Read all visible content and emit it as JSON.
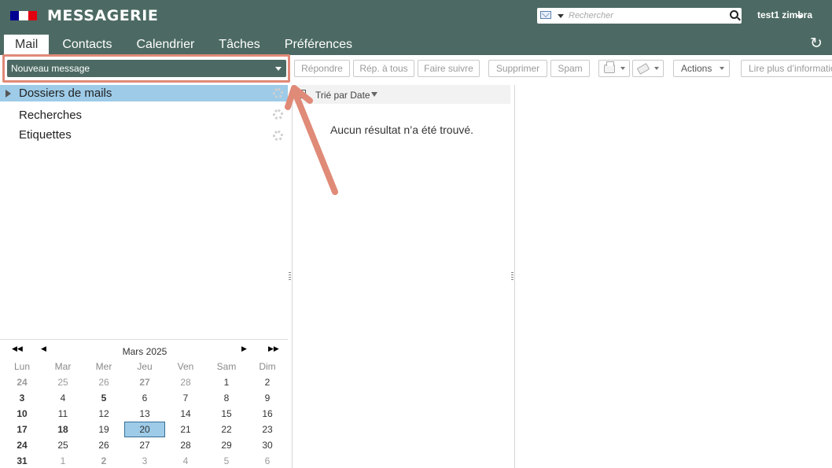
{
  "header": {
    "app_title": "MESSAGERIE",
    "search_placeholder": "Rechercher",
    "user": "test1 zimbra",
    "flag_colors": [
      "#000091",
      "#ffffff",
      "#e1000f"
    ],
    "brand_color": "#4c6a63"
  },
  "tabs": [
    {
      "label": "Mail",
      "active": true
    },
    {
      "label": "Contacts"
    },
    {
      "label": "Calendrier"
    },
    {
      "label": "Tâches"
    },
    {
      "label": "Préférences"
    }
  ],
  "toolbar": {
    "new_message": "Nouveau message",
    "reply": "Répondre",
    "reply_all": "Rép. à tous",
    "forward": "Faire suivre",
    "delete": "Supprimer",
    "spam": "Spam",
    "actions": "Actions",
    "read_more": "Lire plus d’information"
  },
  "sidebar": {
    "folders": "Dossiers de mails",
    "searches": "Recherches",
    "tags": "Etiquettes"
  },
  "list": {
    "sort_label": "Trié par Date",
    "empty": "Aucun résultat n’a été trouvé."
  },
  "calendar": {
    "month": "Mars 2025",
    "nav": {
      "prev_year": "◀◀",
      "prev": "◀",
      "next": "▶",
      "next_year": "▶▶"
    },
    "weekdays": [
      "Lun",
      "Mar",
      "Mer",
      "Jeu",
      "Ven",
      "Sam",
      "Dim"
    ],
    "weeks": [
      [
        "24",
        "25",
        "26",
        "27",
        "28",
        "1",
        "2"
      ],
      [
        "3",
        "4",
        "5",
        "6",
        "7",
        "8",
        "9"
      ],
      [
        "10",
        "11",
        "12",
        "13",
        "14",
        "15",
        "16"
      ],
      [
        "17",
        "18",
        "19",
        "20",
        "21",
        "22",
        "23"
      ],
      [
        "24",
        "25",
        "26",
        "27",
        "28",
        "29",
        "30"
      ],
      [
        "31",
        "1",
        "2",
        "3",
        "4",
        "5",
        "6"
      ]
    ],
    "selected": "20",
    "highlight_color": "#9dcbe8"
  },
  "annotation": {
    "color": "#e08a78"
  }
}
